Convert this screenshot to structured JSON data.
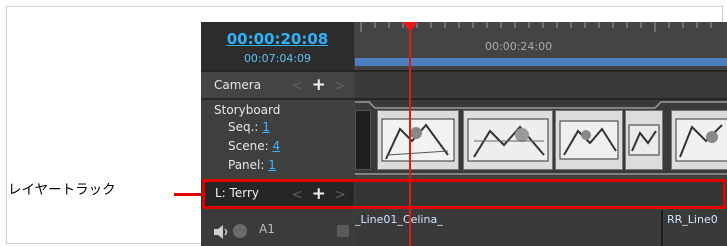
{
  "callout": {
    "label": "レイヤートラック"
  },
  "timecode": {
    "main": "00:00:20:08",
    "sub": "00:07:04:09"
  },
  "ruler": {
    "time_label": "00:00:24:00"
  },
  "tracks": {
    "camera": {
      "label": "Camera",
      "prev": "<",
      "add": "+",
      "next": ">"
    },
    "storyboard": {
      "title": "Storyboard",
      "seq_label": "Seq.:",
      "seq_value": "1",
      "scene_label": "Scene:",
      "scene_value": "4",
      "panel_label": "Panel:",
      "panel_value": "1"
    },
    "layer": {
      "label": "L: Terry",
      "prev": "<",
      "add": "+",
      "next": ">"
    },
    "audio": {
      "label": "A1",
      "clip_left": "_Line01_Celina_",
      "clip_right": "RR_Line0"
    }
  },
  "colors": {
    "accent": "#2fb2ff",
    "playhead": "#e11a1a",
    "highlight": "#e00000"
  }
}
